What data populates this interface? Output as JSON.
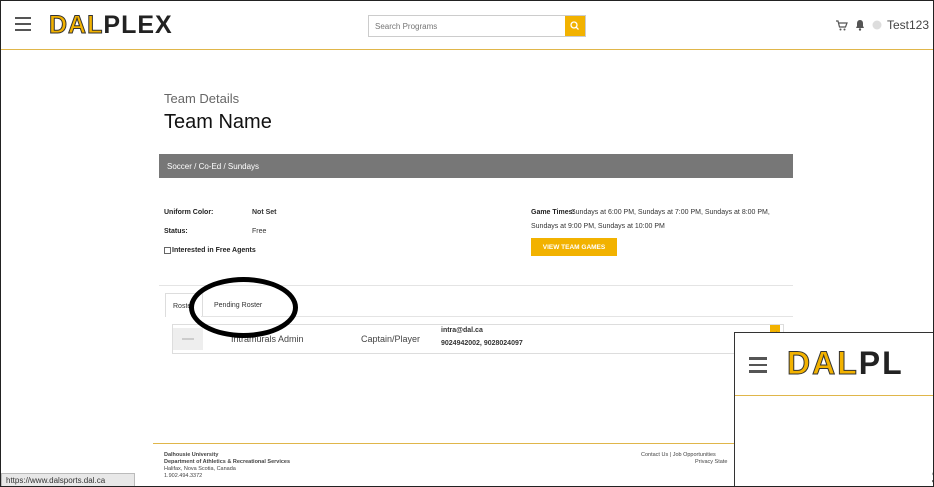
{
  "header": {
    "logo_part1": "DAL",
    "logo_part2": "PLEX",
    "search_placeholder": "Search Programs",
    "user_name": "Test123"
  },
  "page": {
    "subtitle": "Team Details",
    "title": "Team Name",
    "league": "Soccer / Co-Ed / Sundays"
  },
  "details": {
    "uniform_label": "Uniform Color:",
    "uniform_value": "Not Set",
    "status_label": "Status:",
    "status_value": "Free",
    "free_agents_label": "Interested in Free Agents",
    "game_times_label": "Game Times:",
    "game_times_line1": "Sundays at 6:00 PM, Sundays at 7:00 PM, Sundays at 8:00 PM,",
    "game_times_line2": "Sundays at 9:00 PM, Sundays at 10:00 PM",
    "view_games_button": "VIEW TEAM GAMES"
  },
  "tabs": {
    "roster": "Roster",
    "pending": "Pending Roster"
  },
  "roster": [
    {
      "name": "Intramurals Admin",
      "role": "Captain/Player",
      "email": "intra@dal.ca",
      "phones": "9024942002, 9028024097"
    }
  ],
  "footer": {
    "line1": "Dalhousie University",
    "line2": "Department of Athletics & Recreational Services",
    "line3": "Halifax, Nova Scotia, Canada",
    "line4": "1.902.494.3372",
    "links": "Contact Us | Job Opportunities",
    "privacy": "Privacy State"
  },
  "status_bar_url": "https://www.dalsports.dal.ca",
  "inset": {
    "logo_part1": "DAL",
    "logo_part2": "PL",
    "cut_glyph_1": "T",
    "cut_glyph_2": "S"
  },
  "colors": {
    "accent": "#f2b200",
    "bar": "#777777",
    "divider": "#e0b64a"
  },
  "icons": [
    "menu-icon",
    "search-icon",
    "cart-icon",
    "bell-icon",
    "user-avatar-icon",
    "edit-icon",
    "circle-annotation"
  ]
}
